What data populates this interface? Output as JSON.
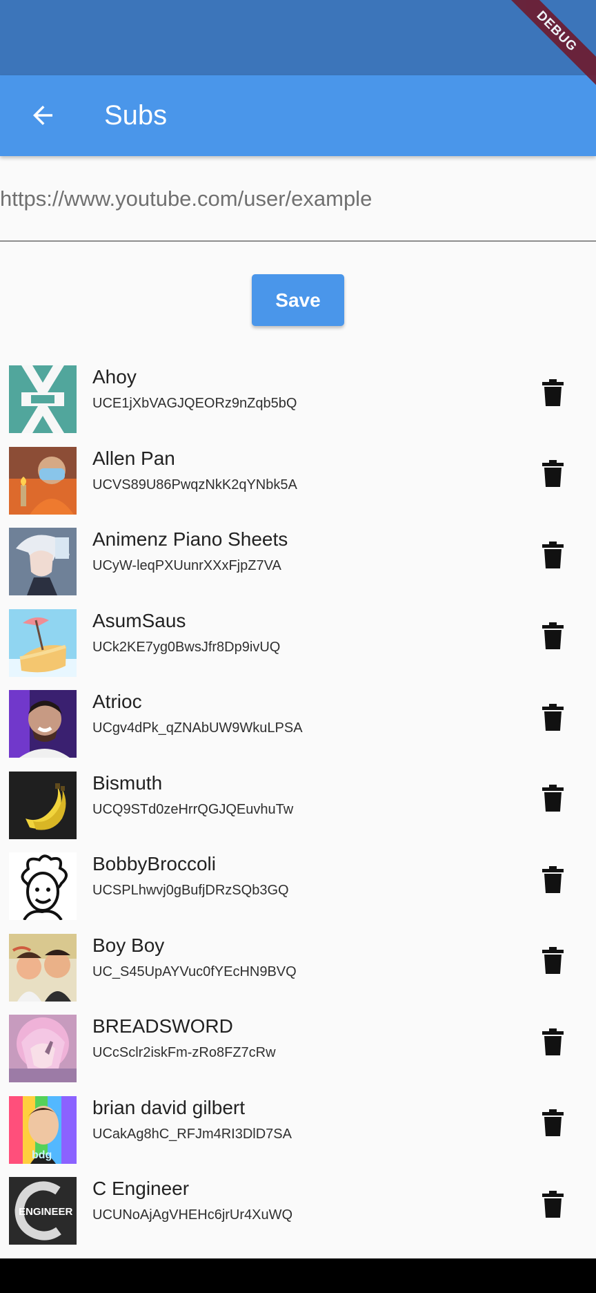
{
  "app_bar": {
    "title": "Subs",
    "back_icon": "arrow-left-icon",
    "color": "#4a96ea"
  },
  "status_bar": {
    "color": "#3c75ba"
  },
  "debug_banner": {
    "label": "DEBUG",
    "color": "#6d1d31"
  },
  "url_input": {
    "placeholder": "https://www.youtube.com/user/example",
    "value": ""
  },
  "actions": {
    "save_label": "Save"
  },
  "channels": [
    {
      "name": "Ahoy",
      "id": "UCE1jXbVAGJQEORz9nZqb5bQ",
      "avatar_icon": "ahoy-logo-icon",
      "delete_icon": "trash-icon"
    },
    {
      "name": "Allen Pan",
      "id": "UCVS89U86PwqzNkK2qYNbk5A",
      "avatar_icon": "allen-pan-avatar-icon",
      "delete_icon": "trash-icon"
    },
    {
      "name": "Animenz Piano Sheets",
      "id": "UCyW-leqPXUunrXXxFjpZ7VA",
      "avatar_icon": "animenz-avatar-icon",
      "delete_icon": "trash-icon"
    },
    {
      "name": "AsumSaus",
      "id": "UCk2KE7yg0BwsJfr8Dp9ivUQ",
      "avatar_icon": "asumsaus-avatar-icon",
      "delete_icon": "trash-icon"
    },
    {
      "name": "Atrioc",
      "id": "UCgv4dPk_qZNAbUW9WkuLPSA",
      "avatar_icon": "atrioc-avatar-icon",
      "delete_icon": "trash-icon"
    },
    {
      "name": "Bismuth",
      "id": "UCQ9STd0zeHrrQGJQEuvhuTw",
      "avatar_icon": "bismuth-banana-icon",
      "delete_icon": "trash-icon"
    },
    {
      "name": "BobbyBroccoli",
      "id": "UCSPLhwvj0gBufjDRzSQb3GQ",
      "avatar_icon": "bobbybroccoli-avatar-icon",
      "delete_icon": "trash-icon"
    },
    {
      "name": "Boy Boy",
      "id": "UC_S45UpAYVuc0fYEcHN9BVQ",
      "avatar_icon": "boy-boy-avatar-icon",
      "delete_icon": "trash-icon"
    },
    {
      "name": "BREADSWORD",
      "id": "UCcSclr2iskFm-zRo8FZ7cRw",
      "avatar_icon": "breadsword-avatar-icon",
      "delete_icon": "trash-icon"
    },
    {
      "name": "brian david gilbert",
      "id": "UCakAg8hC_RFJm4RI3DlD7SA",
      "avatar_icon": "brian-david-gilbert-avatar-icon",
      "delete_icon": "trash-icon"
    },
    {
      "name": "C Engineer",
      "id": "UCUNoAjAgVHEHc6jrUr4XuWQ",
      "avatar_icon": "c-engineer-logo-icon",
      "delete_icon": "trash-icon"
    }
  ]
}
